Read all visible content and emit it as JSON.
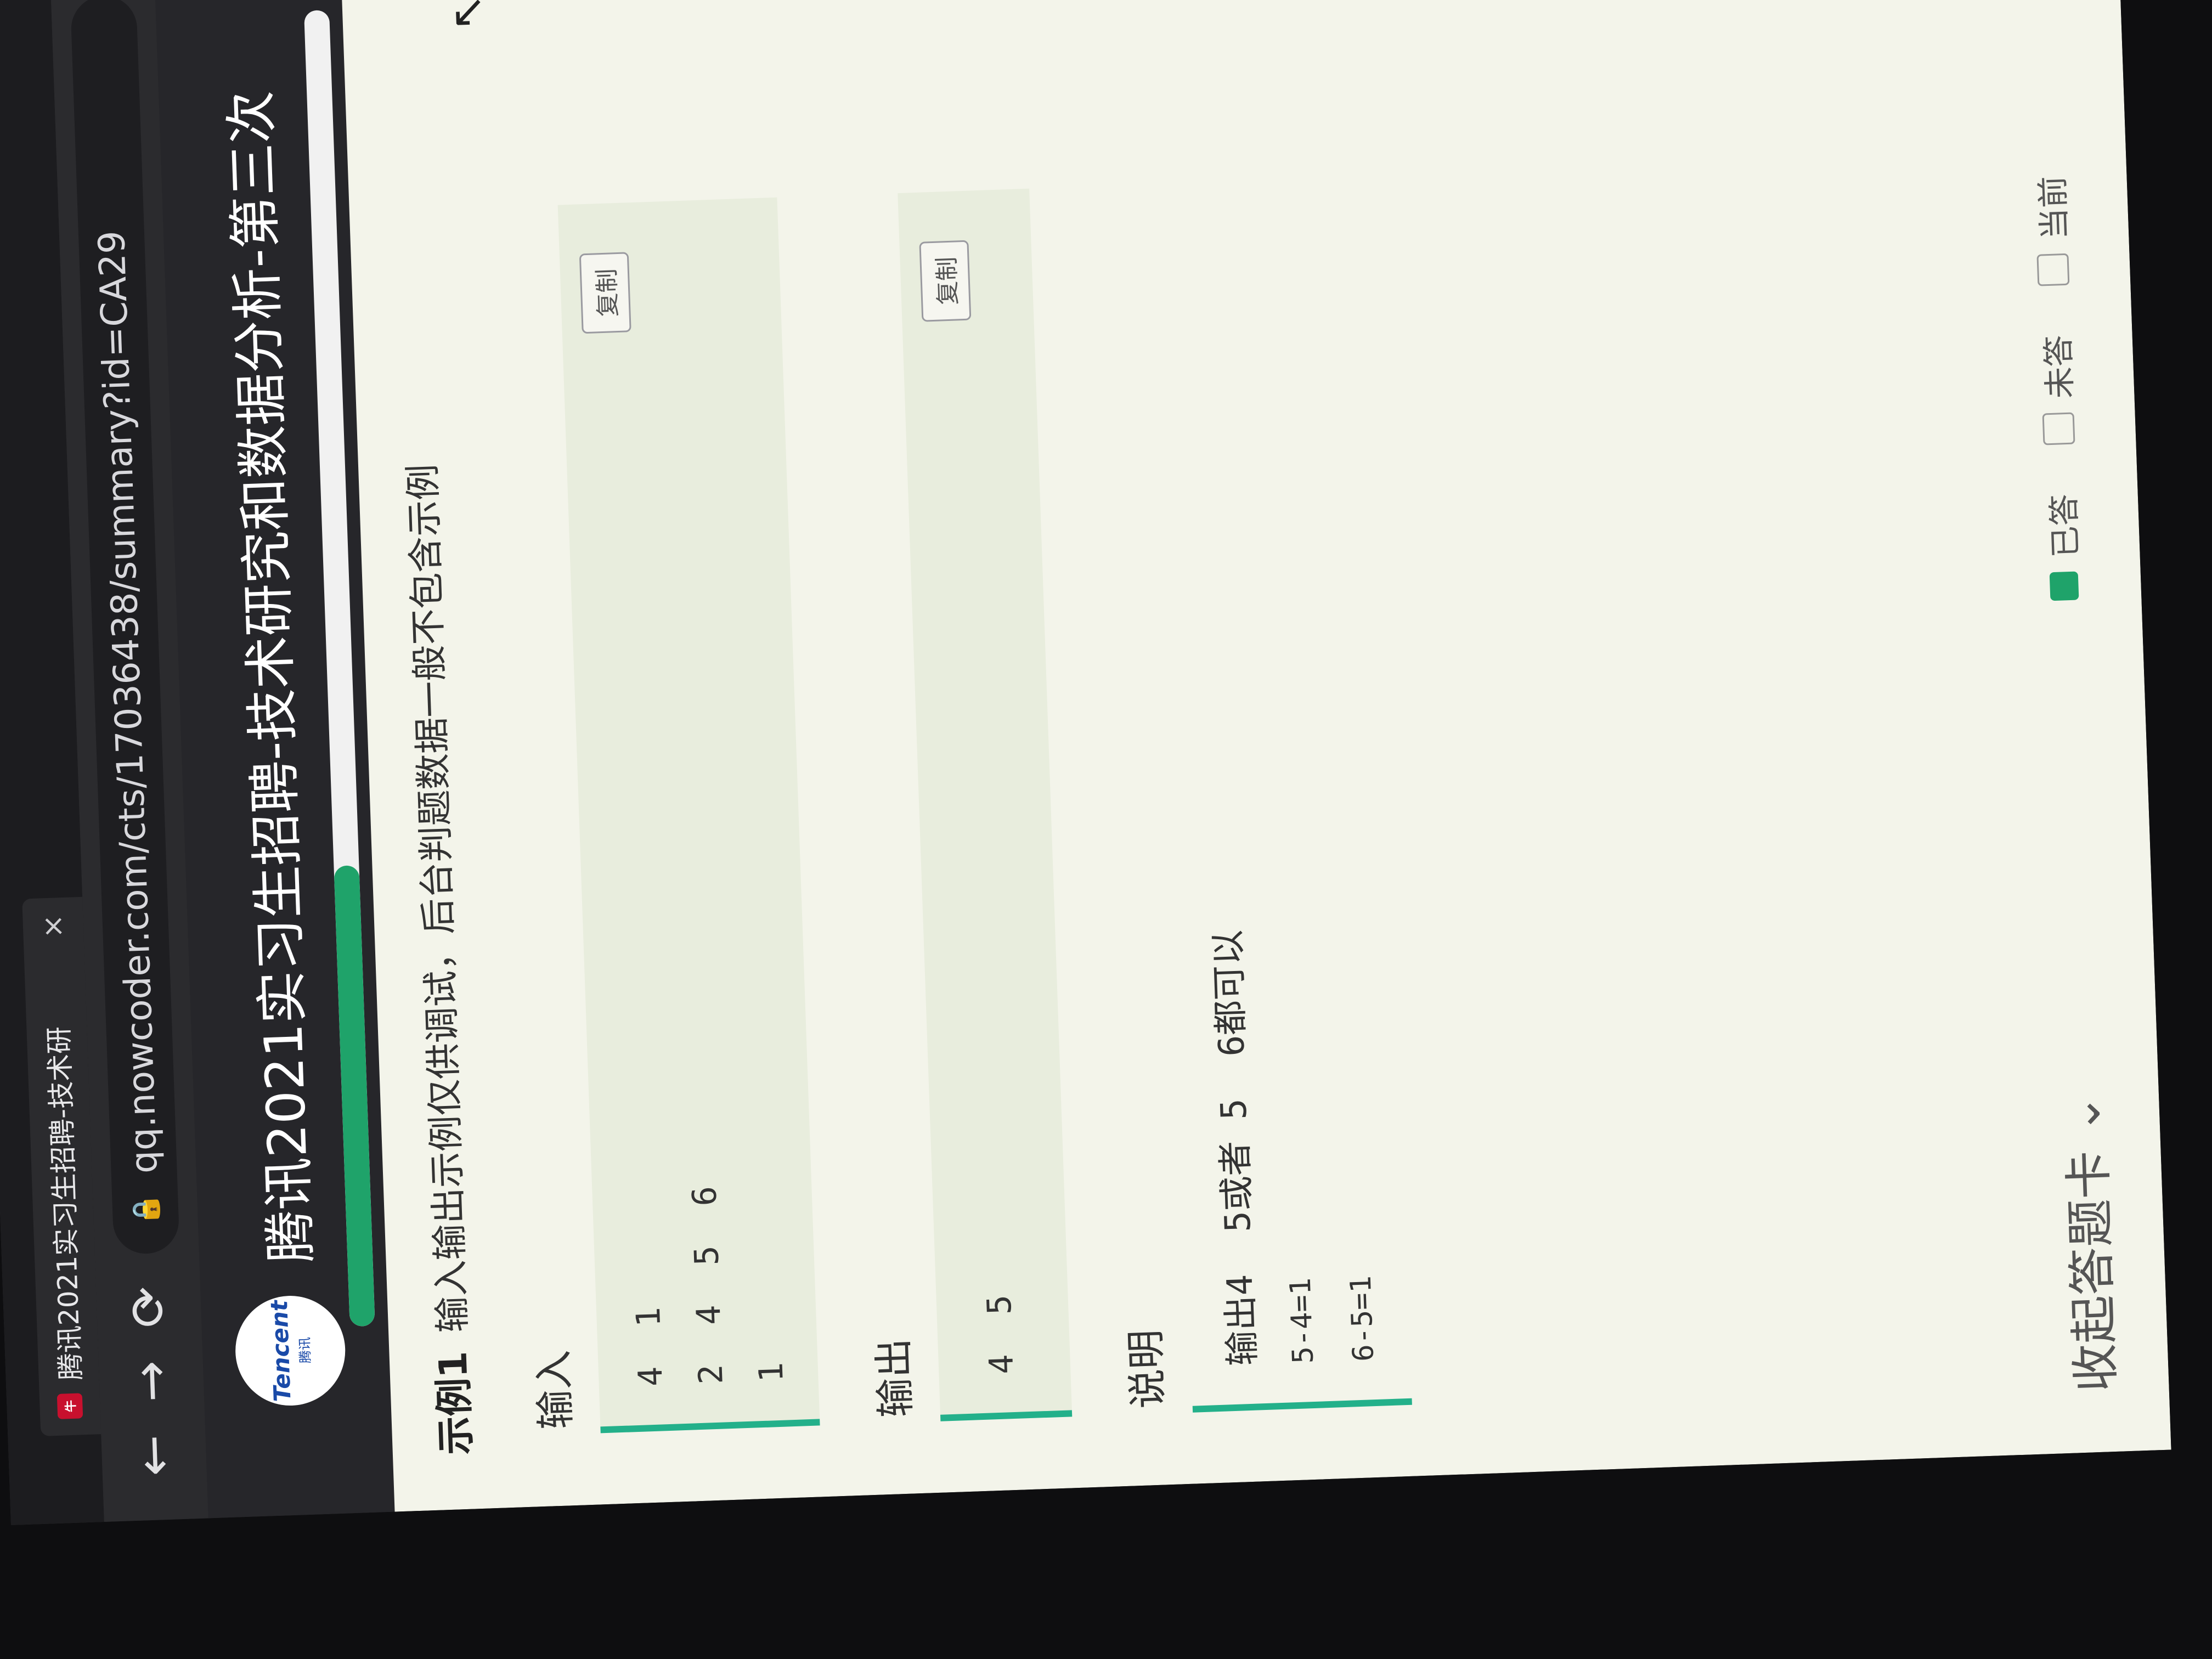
{
  "browser": {
    "tab_title": "腾讯2021实习生招聘-技术研",
    "tab_close": "×",
    "back": "←",
    "forward": "→",
    "reload": "⟳",
    "url": "qq.nowcoder.com/cts/17036438/summary?id=CA29"
  },
  "header": {
    "logo_text": "Tencent",
    "logo_sub": "腾讯",
    "exam_title": "腾讯2021实习生招聘-技术研究和数据分析-第三次",
    "progress": 0.35,
    "colors": {
      "progress": "#1fa36a"
    }
  },
  "example": {
    "label": "示例1",
    "note": "输入输出示例仅供调试，后台判题数据一般不包含示例",
    "input_label": "输入",
    "input_lines": [
      "4  1",
      "2  4  5  6",
      "1"
    ],
    "output_label": "输出",
    "output_lines": [
      "4  5"
    ],
    "copy_label": "复制",
    "explain_label": "说明",
    "explain_lines": [
      "输出4  5或者 5  6都可以",
      "5-4=1",
      "6-5=1"
    ]
  },
  "footer": {
    "collapse_label": "收起答题卡",
    "legend": [
      {
        "label": "已答",
        "color": "#1fa36a"
      },
      {
        "label": "未答",
        "color": "#f3f4ea"
      },
      {
        "label": "当前",
        "color": "#f3f4ea"
      }
    ]
  },
  "colors": {
    "accent": "#23b08a",
    "page_bg": "#f3f4ea"
  }
}
